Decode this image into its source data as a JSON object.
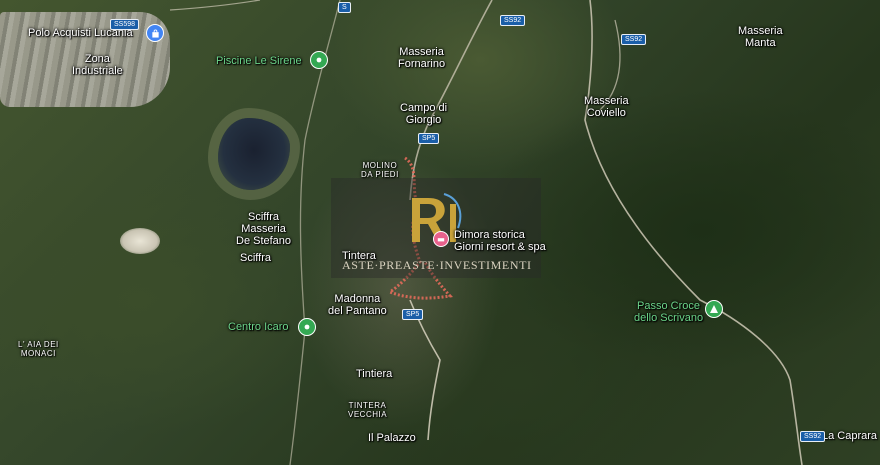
{
  "map": {
    "places": {
      "polo_acquisti": "Polo Acquisti Lucania",
      "zona_industriale": "Zona\nIndustriale",
      "piscine": "Piscine Le Sirene",
      "masseria_fornarino": "Masseria\nFornarino",
      "masseria_manta": "Masseria\nManta",
      "campo_di_giorgio": "Campo di\nGiorgio",
      "masseria_coviello": "Masseria\nCoviello",
      "molino_da_piedi": "MOLINO\nDA PIEDI",
      "sciffra_masseria": "Sciffra\nMasseria\nDe Stefano",
      "sciffra": "Sciffra",
      "dimora": "Dimora storica\nGiorni resort & spa",
      "tintera": "Tintera",
      "madonna_del_pantano": "Madonna\ndel Pantano",
      "centro_icaro": "Centro Icaro",
      "l_aia_dei_monaci": "L' AIA DEI\nMONACI",
      "passo_croce": "Passo Croce\ndello Scrivano",
      "tintiera": "Tintiera",
      "tintera_vecchia": "TINTERA\nVECCHIA",
      "il_palazzo": "Il Palazzo",
      "la_caprara": "La Caprara"
    },
    "roads": {
      "ss92_top": "SS92",
      "ss92_mid": "SS92",
      "sp5_upper": "SP5",
      "sp5_lower": "SP5",
      "ss92_bottom": "SS92",
      "ss598": "SS598",
      "s_road": "S"
    },
    "pins": {
      "shopping": {
        "icon": "shopping-bag-icon",
        "color": "#4285f4"
      },
      "piscine": {
        "icon": "pool-icon",
        "color": "#34a853"
      },
      "centro_icaro": {
        "icon": "activity-icon",
        "color": "#34a853"
      },
      "passo_croce": {
        "icon": "mountain-icon",
        "color": "#34a853"
      },
      "dimora": {
        "icon": "hotel-icon",
        "color": "#e8618c"
      }
    },
    "boundary_color": "#e26a5a",
    "river_color": "#c9c3b0"
  },
  "watermark": {
    "text": "ASTE·PREASTE·INVESTIMENTI",
    "logo": "RI-logo-icon"
  }
}
